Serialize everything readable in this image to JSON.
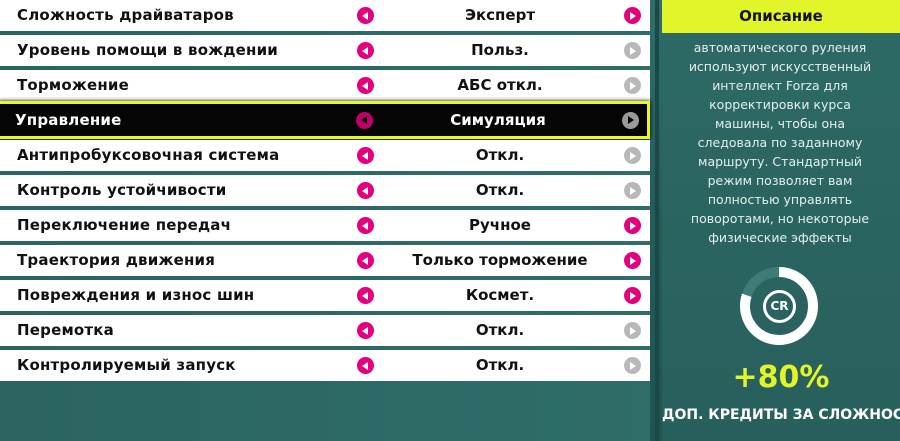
{
  "settings": [
    {
      "label": "Сложность драйватаров",
      "value": "Эксперт",
      "left_active": true,
      "right_active": true
    },
    {
      "label": "Уровень помощи в вождении",
      "value": "Польз.",
      "left_active": true,
      "right_active": false
    },
    {
      "label": "Торможение",
      "value": "АБС откл.",
      "left_active": true,
      "right_active": false
    },
    {
      "label": "Управление",
      "value": "Симуляция",
      "left_active": true,
      "right_active": false,
      "selected": true
    },
    {
      "label": "Антипробуксовочная система",
      "value": "Откл.",
      "left_active": true,
      "right_active": false
    },
    {
      "label": "Контроль устойчивости",
      "value": "Откл.",
      "left_active": true,
      "right_active": false
    },
    {
      "label": "Переключение передач",
      "value": "Ручное",
      "left_active": true,
      "right_active": true
    },
    {
      "label": "Траектория движения",
      "value": "Только торможение",
      "left_active": true,
      "right_active": true
    },
    {
      "label": "Повреждения и износ шин",
      "value": "Космет.",
      "left_active": true,
      "right_active": true
    },
    {
      "label": "Перемотка",
      "value": "Откл.",
      "left_active": true,
      "right_active": false
    },
    {
      "label": "Контролируемый запуск",
      "value": "Откл.",
      "left_active": true,
      "right_active": false
    }
  ],
  "description": {
    "title": "Описание",
    "text": "автоматического руления используют искусственный интеллект Forza для корректировки курса машины, чтобы она следовала по заданному маршруту. Стандартный режим позволяет вам полностью управлять поворотами, но некоторые физические эффекты сглаживаются для облегчения"
  },
  "credits": {
    "badge": "CR",
    "bonus": "+80%",
    "label": "ДОП. КРЕДИТЫ ЗА СЛОЖНОСТЬ",
    "ring_fraction": 0.8
  },
  "colors": {
    "accent_yellow": "#e2f42a",
    "arrow_active": "#e4007c",
    "arrow_inactive": "#b8b8b8",
    "background_teal": "#2d6a66"
  }
}
